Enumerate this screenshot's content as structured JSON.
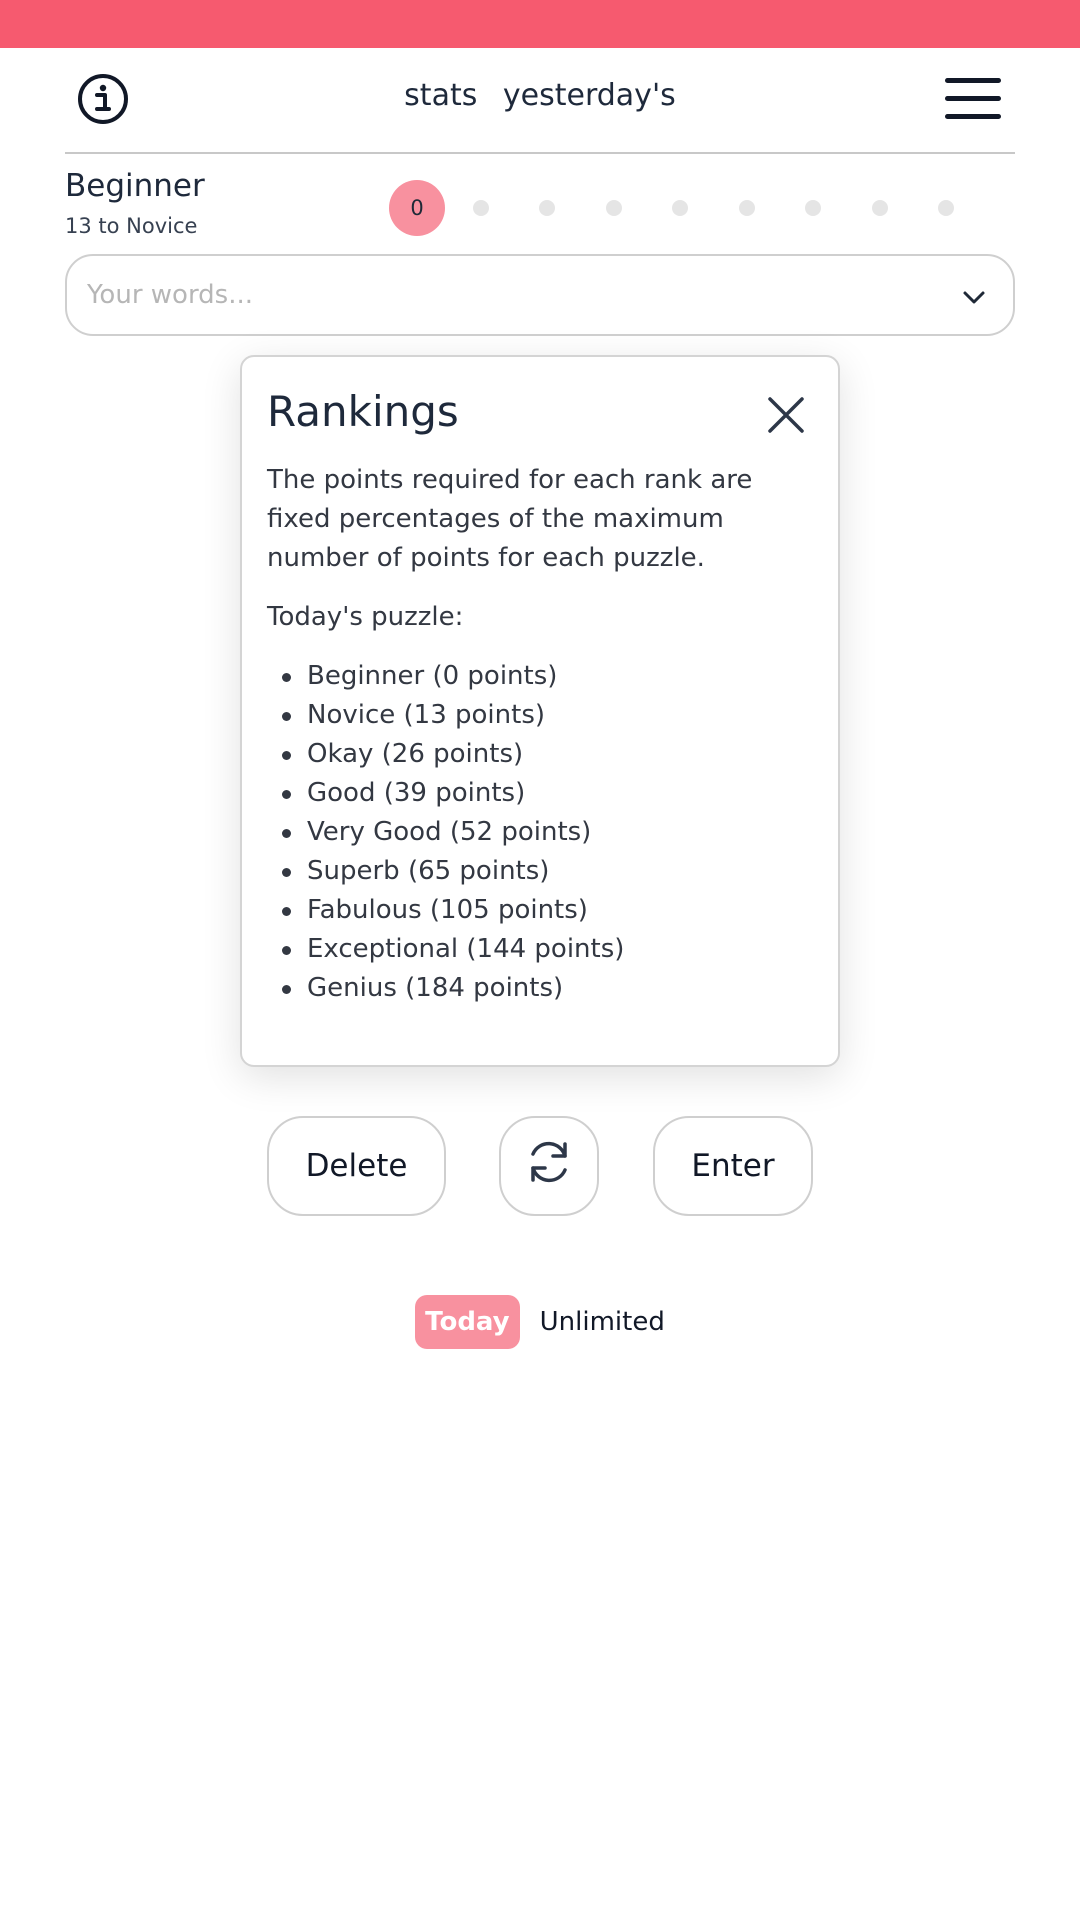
{
  "header": {
    "links": [
      "stats",
      "yesterday's"
    ]
  },
  "rank": {
    "current": "Beginner",
    "next_hint": "13 to Novice",
    "score": "0",
    "total_steps": 9,
    "progress_fraction": 0
  },
  "words": {
    "placeholder": "Your words..."
  },
  "modal": {
    "title": "Rankings",
    "description": "The points required for each rank are fixed percentages of the maximum number of points for each puzzle.",
    "subheading": "Today's puzzle:",
    "ranks": [
      "Beginner (0 points)",
      "Novice (13 points)",
      "Okay (26 points)",
      "Good (39 points)",
      "Very Good (52 points)",
      "Superb (65 points)",
      "Fabulous (105 points)",
      "Exceptional (144 points)",
      "Genius (184 points)"
    ]
  },
  "actions": {
    "delete_label": "Delete",
    "shuffle_icon": "refresh-icon",
    "enter_label": "Enter"
  },
  "modes": {
    "today_label": "Today",
    "unlimited_label": "Unlimited"
  },
  "colors": {
    "topbar": "#f65a6f",
    "accent": "#f8919f",
    "inactive_dot": "#e5e5e5"
  }
}
